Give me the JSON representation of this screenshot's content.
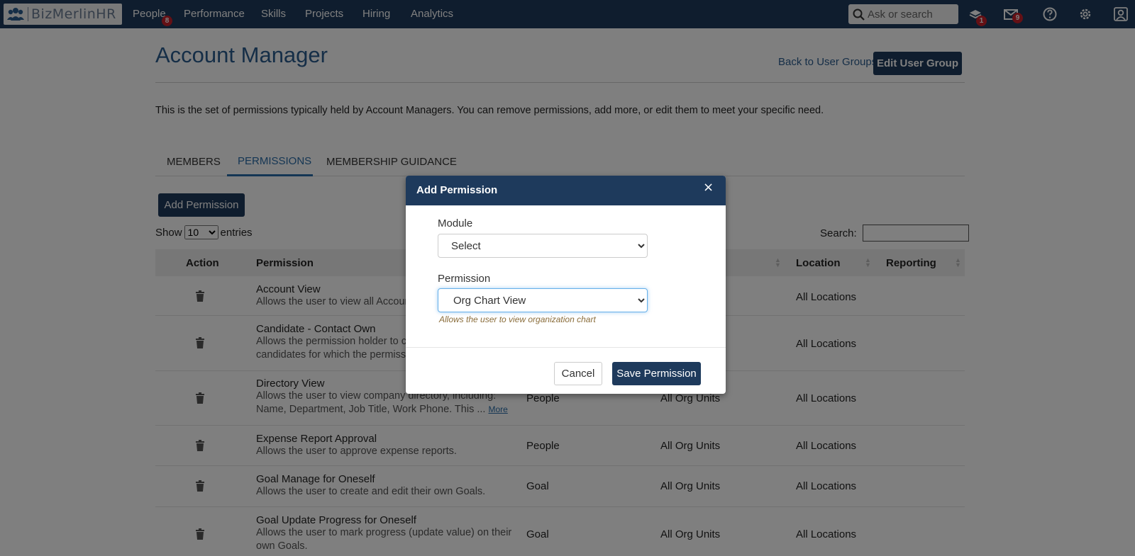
{
  "nav": {
    "logo_text": "BizMerlinHR",
    "items": [
      {
        "label": "People",
        "badge": "8"
      },
      {
        "label": "Performance"
      },
      {
        "label": "Skills"
      },
      {
        "label": "Projects"
      },
      {
        "label": "Hiring"
      },
      {
        "label": "Analytics"
      }
    ],
    "search_placeholder": "Ask or search",
    "inbox_badge": "1",
    "mail_badge": "9",
    "bar_color": "#1e3a5c",
    "badge_color": "#c8202a"
  },
  "page": {
    "title": "Account Manager",
    "back_link": "Back to User Groups",
    "edit_button": "Edit User Group",
    "description": "This is the set of permissions typically held by Account Managers. You can remove permissions, add more, or edit them to meet your specific need.",
    "tabs": [
      {
        "label": "MEMBERS",
        "active": false
      },
      {
        "label": "PERMISSIONS",
        "active": true
      },
      {
        "label": "MEMBERSHIP GUIDANCE",
        "active": false
      }
    ],
    "add_button": "Add Permission",
    "show_label": "Show",
    "entries_value": "10",
    "entries_label": "entries",
    "search_label": "Search:"
  },
  "table": {
    "headers": {
      "action": "Action",
      "permission": "Permission",
      "location": "Location",
      "reporting": "Reporting"
    },
    "rows": [
      {
        "name": "Account View",
        "desc1": "Allows the user to view all Account",
        "desc2": "",
        "module": "",
        "org": "",
        "location": "All Locations"
      },
      {
        "name": "Candidate - Contact Own",
        "desc1": "Allows the permission holder to co",
        "desc2": "candidates for which the permissio",
        "module": "",
        "org": "",
        "location": "All Locations"
      },
      {
        "name": "Directory View",
        "desc1": "Allows the user to view company directory, including:",
        "desc2": "Name, Department, Job Title, Work Phone. This ...",
        "more": "More",
        "module": "People",
        "org": "All Org Units",
        "location": "All Locations"
      },
      {
        "name": "Expense Report Approval",
        "desc1": "Allows the user to approve expense reports.",
        "desc2": "",
        "module": "People",
        "org": "All Org Units",
        "location": "All Locations"
      },
      {
        "name": "Goal Manage for Oneself",
        "desc1": "Allows the user to create and edit their own Goals.",
        "desc2": "",
        "module": "Goal",
        "org": "All Org Units",
        "location": "All Locations"
      },
      {
        "name": "Goal Update Progress for Oneself",
        "desc1": "Allows the user to mark progress (update value) on their",
        "desc2": "own Goals.",
        "module": "Goal",
        "org": "All Org Units",
        "location": "All Locations"
      }
    ]
  },
  "modal": {
    "title": "Add Permission",
    "close": "×",
    "module_label": "Module",
    "module_value": "Select",
    "permission_label": "Permission",
    "permission_value": "Org Chart View",
    "help_text": "Allows the user to view organization chart",
    "cancel": "Cancel",
    "save": "Save Permission"
  }
}
